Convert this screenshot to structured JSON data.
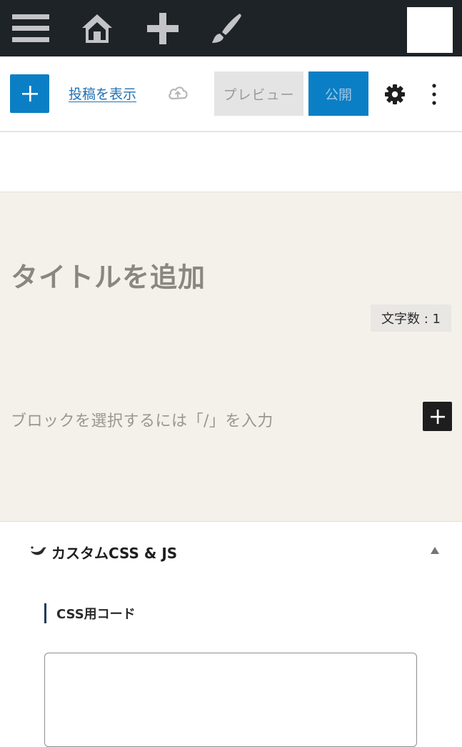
{
  "admin_bar": {
    "icons": [
      "menu-icon",
      "home-icon",
      "plus-icon",
      "brush-icon"
    ],
    "background": "#1d2327"
  },
  "toolbar": {
    "view_post_label": "投稿を表示",
    "preview_label": "プレビュー",
    "publish_label": "公開",
    "accent": "#0b7fc5"
  },
  "editor": {
    "title_placeholder": "タイトルを追加",
    "char_count": "文字数 : 1",
    "block_placeholder": "ブロックを選択するには「/」を入力",
    "canvas_background": "#f4f1eb"
  },
  "meta_box": {
    "title": "カスタムCSS & JS",
    "css_label": "CSS用コード"
  }
}
